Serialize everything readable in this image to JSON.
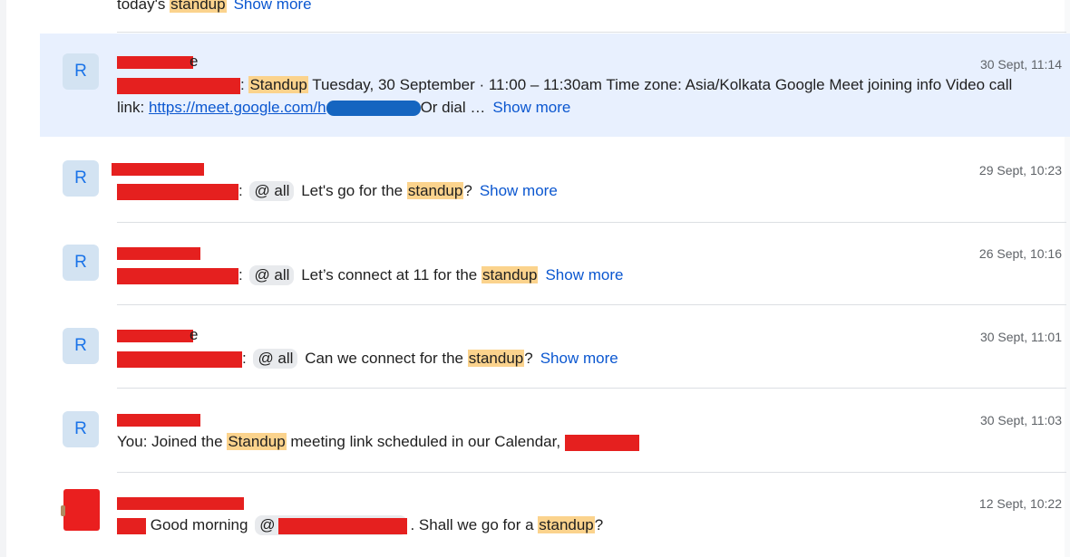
{
  "partial_row": {
    "prefix": "today's ",
    "highlight": "standup",
    "show_more": "Show more"
  },
  "results": [
    {
      "avatar_letter": "R",
      "time": "30 Sept, 11:14",
      "title_tail": "e",
      "highlight": "Standup",
      "text_a": " Tuesday, 30 September · 11:00 – 11:30am Time zone: Asia/Kolkata Google Meet joining info Video call link: ",
      "link": "https://meet.google.com/h",
      "text_b": "Or dial …",
      "show_more": "Show more"
    },
    {
      "avatar_letter": "R",
      "time": "29 Sept, 10:23",
      "mention": "@ all",
      "text_pre": "Let's go for the ",
      "highlight": "standup",
      "text_post": "?",
      "show_more": "Show more"
    },
    {
      "avatar_letter": "R",
      "time": "26 Sept, 10:16",
      "mention": "@ all",
      "text_pre": "Let’s connect at 11 for the ",
      "highlight": "standup",
      "text_post": "",
      "show_more": "Show more"
    },
    {
      "avatar_letter": "R",
      "time": "30 Sept, 11:01",
      "title_tail": "e",
      "mention": "@ all",
      "text_pre": "Can we connect for the ",
      "highlight": "standup",
      "text_post": "?",
      "show_more": "Show more"
    },
    {
      "avatar_letter": "R",
      "time": "30 Sept, 11:03",
      "text_pre": "You: Joined the ",
      "highlight": "Standup",
      "text_post": " meeting link scheduled in our Calendar, "
    },
    {
      "time": "12 Sept, 10:22",
      "text_pre": " Good morning ",
      "mention": "@",
      "text_mid": ". Shall we go for a ",
      "highlight": "standup",
      "text_post": "?"
    }
  ],
  "colors": {
    "highlight": "#fbd38d",
    "link": "#0b57d0",
    "selected_row": "#e8f0fe",
    "redaction": "#e5201f"
  }
}
